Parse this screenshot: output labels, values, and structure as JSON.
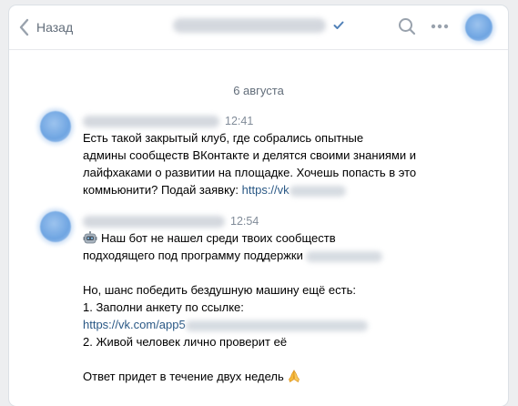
{
  "header": {
    "back_label": "Назад",
    "icons": [
      "chevron-left-icon",
      "verified-check-icon",
      "search-icon",
      "more-dots-icon"
    ]
  },
  "date_separator": "6 августа",
  "messages": [
    {
      "time": "12:41",
      "lines": [
        "Есть такой закрытый клуб, где собрались опытные",
        "админы сообществ ВКонтакте и делятся своими знаниями и",
        "лайфхаками о развитии на площадке. Хочешь попасть в это",
        "коммьюнити? Подай заявку: "
      ],
      "link": "https://vk"
    },
    {
      "time": "12:54",
      "line1": "Наш бот не нашел среди твоих сообществ",
      "line2": "подходящего под программу поддержки ",
      "line3": "Но, шанс победить бездушную машину ещё есть:",
      "line4": "1. Заполни анкету по ссылке:",
      "link": "https://vk.com/app5",
      "line6": "2. Живой человек лично проверит её",
      "line7": "Ответ придет в течение двух недель"
    }
  ],
  "colors": {
    "accent_link": "#2a5885",
    "secondary_text": "#626d7a",
    "time_text": "#818c99",
    "verified": "#5181b8",
    "background": "#edeef0"
  }
}
